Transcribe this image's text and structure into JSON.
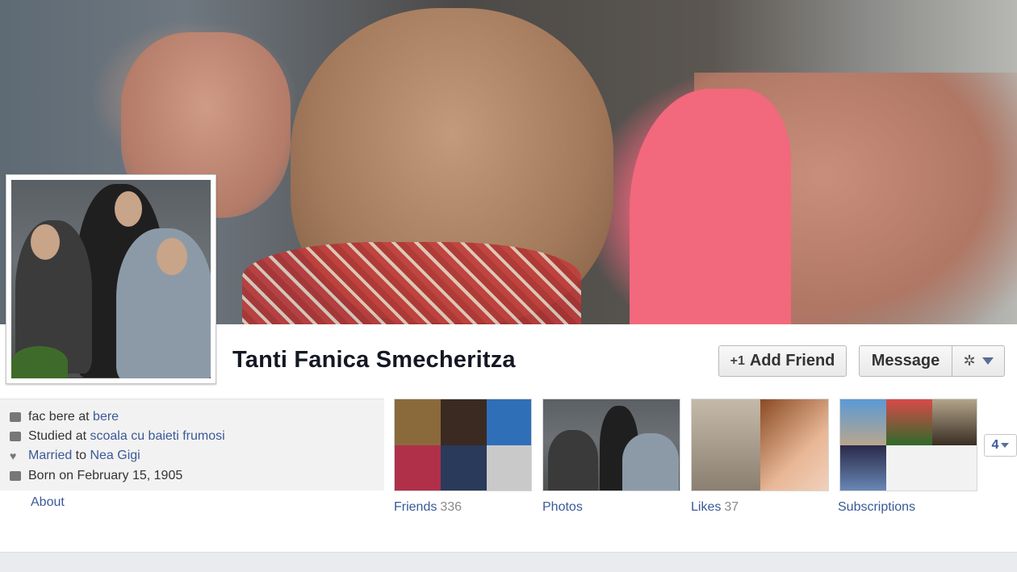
{
  "profile": {
    "name": "Tanti Fanica Smecheritza"
  },
  "actions": {
    "add_friend_label": "Add Friend",
    "message_label": "Message"
  },
  "info": {
    "work_prefix": "fac bere at ",
    "work_link": "bere",
    "study_prefix": "Studied at ",
    "study_link": "scoala cu baieti frumosi",
    "relationship_link": "Married",
    "relationship_suffix": " to ",
    "partner_link": "Nea Gigi",
    "born": "Born on February 15, 1905",
    "about_label": "About"
  },
  "tiles": {
    "friends_label": "Friends",
    "friends_count": "336",
    "photos_label": "Photos",
    "likes_label": "Likes",
    "likes_count": "37",
    "subscriptions_label": "Subscriptions"
  },
  "more": {
    "count": "4"
  },
  "icons": {
    "work": "briefcase-icon",
    "education": "graduation-cap-icon",
    "relationship": "heart-icon",
    "birthday": "calendar-icon",
    "add_friend": "add-friend-icon",
    "settings": "gear-icon"
  },
  "colors": {
    "link": "#3b5998",
    "name": "#141823",
    "info_bg": "#f2f2f2"
  }
}
